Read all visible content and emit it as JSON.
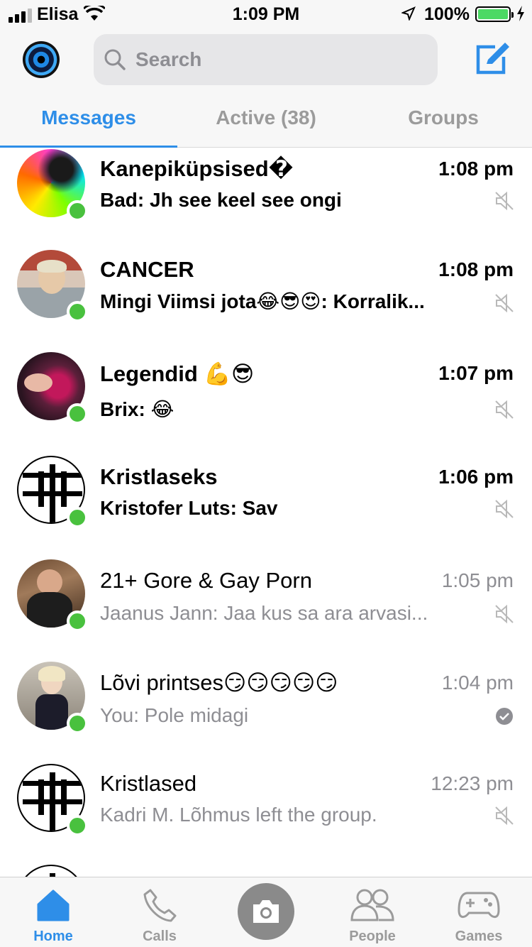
{
  "status_bar": {
    "carrier": "Elisa",
    "time": "1:09 PM",
    "battery": "100%"
  },
  "header": {
    "search_placeholder": "Search",
    "tabs": [
      {
        "label": "Messages",
        "active": true
      },
      {
        "label": "Active (38)",
        "active": false
      },
      {
        "label": "Groups",
        "active": false
      }
    ]
  },
  "conversations": [
    {
      "name": "Kanepiküpsised�",
      "preview": "Bad: Jh see keel see ongi",
      "time": "1:08 pm",
      "unread": true,
      "online": true,
      "status_icon": "muted-icon"
    },
    {
      "name": "CANCER",
      "preview": "Mingi Viimsi jota😂😎😍: Korralik...",
      "time": "1:08 pm",
      "unread": true,
      "online": true,
      "status_icon": "muted-icon"
    },
    {
      "name": "Legendid 💪😎",
      "preview": "Brix: 😂",
      "time": "1:07 pm",
      "unread": true,
      "online": true,
      "status_icon": "muted-icon"
    },
    {
      "name": "Kristlaseks",
      "preview": "Kristofer Luts: Sav",
      "time": "1:06 pm",
      "unread": true,
      "online": true,
      "status_icon": "muted-icon"
    },
    {
      "name": "21+ Gore & Gay Porn",
      "preview": "Jaanus Jann: Jaa kus sa ara arvasi...",
      "time": "1:05 pm",
      "unread": false,
      "online": true,
      "status_icon": "muted-icon"
    },
    {
      "name": "Lõvi printses😏😏😏😏😏",
      "preview": "You: Pole midagi",
      "time": "1:04 pm",
      "unread": false,
      "online": true,
      "status_icon": "seen-check-icon"
    },
    {
      "name": "Kristlased",
      "preview": "Kadri M. Lõhmus left the group.",
      "time": "12:23 pm",
      "unread": false,
      "online": true,
      "status_icon": "muted-icon"
    }
  ],
  "tabbar": {
    "items": [
      {
        "label": "Home",
        "icon": "home-icon",
        "active": true
      },
      {
        "label": "Calls",
        "icon": "phone-icon",
        "active": false
      },
      {
        "label": "",
        "icon": "camera-icon",
        "active": false
      },
      {
        "label": "People",
        "icon": "people-icon",
        "active": false
      },
      {
        "label": "Games",
        "icon": "gamepad-icon",
        "active": false
      }
    ]
  },
  "colors": {
    "accent": "#2e8ee8",
    "online": "#49c13e",
    "muted_text": "#8e8e93"
  }
}
